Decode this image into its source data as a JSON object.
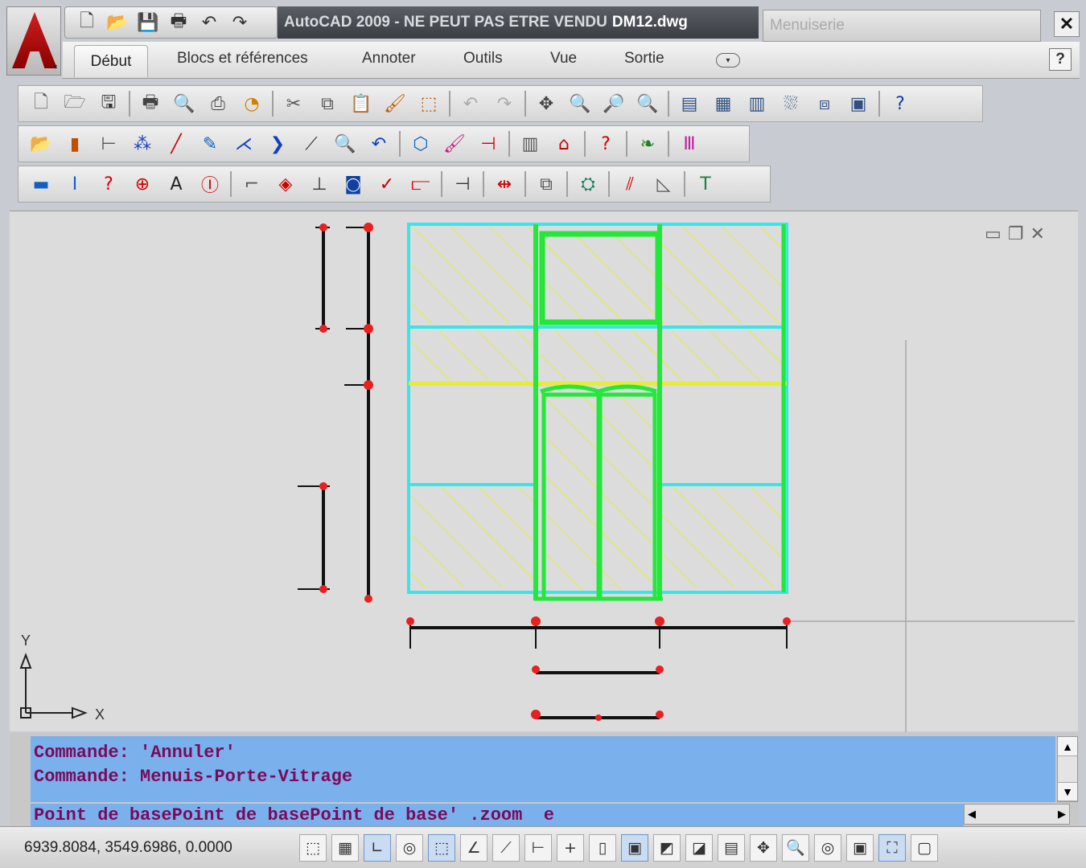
{
  "title_bar": {
    "app_title": "AutoCAD 2009 - NE PEUT PAS ETRE VENDU",
    "file_name": "DM12.dwg",
    "workspace": "Menuiserie",
    "close_glyph": "✕"
  },
  "quick_access": [
    {
      "name": "new-icon",
      "glyph": "🗋"
    },
    {
      "name": "open-icon",
      "glyph": "📂"
    },
    {
      "name": "save-icon",
      "glyph": "💾"
    },
    {
      "name": "print-icon",
      "glyph": "🖶"
    },
    {
      "name": "undo-icon",
      "glyph": "↶"
    },
    {
      "name": "redo-icon",
      "glyph": "↷"
    }
  ],
  "ribbon": {
    "tabs": [
      "Début",
      "Blocs et références",
      "Annoter",
      "Outils",
      "Vue",
      "Sortie"
    ],
    "toggle_glyph": "▾",
    "help_label": "?"
  },
  "toolbar_standard": [
    {
      "name": "new-icon",
      "glyph": "🗋",
      "color": "#555555"
    },
    {
      "name": "open-icon",
      "glyph": "🗁",
      "color": "#555555"
    },
    {
      "name": "save-icon",
      "glyph": "🖫",
      "color": "#333333"
    },
    {
      "sep": true
    },
    {
      "name": "plot-icon",
      "glyph": "🖶",
      "color": "#444444"
    },
    {
      "name": "plot-preview-icon",
      "glyph": "🔍",
      "color": "#444444"
    },
    {
      "name": "publish-icon",
      "glyph": "⎙",
      "color": "#444444"
    },
    {
      "name": "3d-dwf-icon",
      "glyph": "◔",
      "color": "#d08000"
    },
    {
      "sep": true
    },
    {
      "name": "cut-icon",
      "glyph": "✂",
      "color": "#555555"
    },
    {
      "name": "copy-icon",
      "glyph": "⧉",
      "color": "#555555"
    },
    {
      "name": "paste-icon",
      "glyph": "📋",
      "color": "#555555"
    },
    {
      "name": "match-properties-icon",
      "glyph": "🖌",
      "color": "#c06000"
    },
    {
      "name": "block-editor-icon",
      "glyph": "⬚",
      "color": "#c06000"
    },
    {
      "sep": true
    },
    {
      "name": "undo-icon",
      "glyph": "↶",
      "color": "#aaaaaa"
    },
    {
      "name": "redo-icon",
      "glyph": "↷",
      "color": "#aaaaaa"
    },
    {
      "sep": true
    },
    {
      "name": "pan-icon",
      "glyph": "✥",
      "color": "#444444"
    },
    {
      "name": "zoom-realtime-icon",
      "glyph": "🔍",
      "color": "#333333"
    },
    {
      "name": "zoom-window-icon",
      "glyph": "🔎",
      "color": "#333333"
    },
    {
      "name": "zoom-previous-icon",
      "glyph": "🔍",
      "color": "#333333"
    },
    {
      "sep": true
    },
    {
      "name": "properties-icon",
      "glyph": "▤",
      "color": "#305080"
    },
    {
      "name": "design-center-icon",
      "glyph": "▦",
      "color": "#305080"
    },
    {
      "name": "tool-palettes-icon",
      "glyph": "▥",
      "color": "#305080"
    },
    {
      "name": "sheet-set-icon",
      "glyph": "⛆",
      "color": "#305080"
    },
    {
      "name": "markup-icon",
      "glyph": "⧈",
      "color": "#305080"
    },
    {
      "name": "calculator-icon",
      "glyph": "▣",
      "color": "#305080"
    },
    {
      "sep": true
    },
    {
      "name": "help-icon",
      "glyph": "?",
      "color": "#1040a0"
    }
  ],
  "toolbar_menuis1": [
    {
      "name": "open-folder-icon",
      "glyph": "📂",
      "color": "#1060c0"
    },
    {
      "name": "wood-panel-icon",
      "glyph": "▮",
      "color": "#c05000"
    },
    {
      "name": "profile-icon",
      "glyph": "⊢",
      "color": "#555555"
    },
    {
      "name": "nodes-icon",
      "glyph": "⁂",
      "color": "#1040c0"
    },
    {
      "name": "line-icon",
      "glyph": "╱",
      "color": "#d00000"
    },
    {
      "name": "pencil-icon",
      "glyph": "✎",
      "color": "#1060c0"
    },
    {
      "name": "angle-icon",
      "glyph": "⋌",
      "color": "#1040c0"
    },
    {
      "name": "chevron-icon",
      "glyph": "❯",
      "color": "#1040c0"
    },
    {
      "name": "diagonal-icon",
      "glyph": "⟋",
      "color": "#333333"
    },
    {
      "name": "zoom-red-icon",
      "glyph": "🔍",
      "color": "#d00000"
    },
    {
      "name": "rotate-icon",
      "glyph": "↶",
      "color": "#1040c0"
    },
    {
      "sep": true
    },
    {
      "name": "group-icon",
      "glyph": "⬡",
      "color": "#1060c0"
    },
    {
      "name": "paint-icon",
      "glyph": "🖌",
      "color": "#c02080"
    },
    {
      "name": "dimension-icon",
      "glyph": "⊣",
      "color": "#d00000"
    },
    {
      "sep": true
    },
    {
      "name": "frame-icon",
      "glyph": "▥",
      "color": "#555555"
    },
    {
      "name": "house-icon",
      "glyph": "⌂",
      "color": "#c00000"
    },
    {
      "sep": true
    },
    {
      "name": "question-x-icon",
      "glyph": "?",
      "color": "#d00000"
    },
    {
      "sep": true
    },
    {
      "name": "leaf-icon",
      "glyph": "❧",
      "color": "#208020"
    },
    {
      "sep": true
    },
    {
      "name": "comb-icon",
      "glyph": "Ⅲ",
      "color": "#c020a0"
    }
  ],
  "toolbar_menuis2": [
    {
      "name": "panel-icon",
      "glyph": "▬",
      "color": "#1060c0"
    },
    {
      "name": "beam-icon",
      "glyph": "I",
      "color": "#1060c0"
    },
    {
      "name": "question-icon",
      "glyph": "?",
      "color": "#d00000"
    },
    {
      "name": "target-icon",
      "glyph": "⊕",
      "color": "#d00000"
    },
    {
      "name": "text-icon",
      "glyph": "A",
      "color": "#222222"
    },
    {
      "name": "i-frame-icon",
      "glyph": "Ⓘ",
      "color": "#d00000"
    },
    {
      "sep": true
    },
    {
      "name": "corner-icon",
      "glyph": "⌐",
      "color": "#555555"
    },
    {
      "name": "diamond-icon",
      "glyph": "◈",
      "color": "#d00000"
    },
    {
      "name": "auto-icon",
      "glyph": "⊥",
      "color": "#333333"
    },
    {
      "name": "tag-icon",
      "glyph": "◙",
      "color": "#1040a0"
    },
    {
      "name": "check-edit-icon",
      "glyph": "✓",
      "color": "#c00000"
    },
    {
      "name": "bracket-icon",
      "glyph": "⫍",
      "color": "#d00000"
    },
    {
      "sep": true
    },
    {
      "name": "insert-icon",
      "glyph": "⊣",
      "color": "#333333"
    },
    {
      "sep": true
    },
    {
      "name": "split-icon",
      "glyph": "⇹",
      "color": "#d00000"
    },
    {
      "sep": true
    },
    {
      "name": "copy-pages-icon",
      "glyph": "⧉",
      "color": "#555555"
    },
    {
      "sep": true
    },
    {
      "name": "export-icon",
      "glyph": "⛭",
      "color": "#208060"
    },
    {
      "sep": true
    },
    {
      "name": "door-icon",
      "glyph": "⫽",
      "color": "#d00000"
    },
    {
      "name": "ramp-icon",
      "glyph": "◺",
      "color": "#555555"
    },
    {
      "sep": true
    },
    {
      "name": "t-profile-icon",
      "glyph": "T",
      "color": "#208040"
    }
  ],
  "drawing": {
    "window_controls": [
      "▭",
      "❐",
      "✕"
    ],
    "ucs_x_label": "X",
    "ucs_y_label": "Y"
  },
  "command_line": {
    "lines": [
      "Commande: 'Annuler'",
      "Commande: Menuis-Porte-Vitrage"
    ],
    "input": "Point de basePoint de basePoint de base' .zoom  e"
  },
  "status_bar": {
    "coordinates": "6939.8084, 3549.6986, 0.0000",
    "buttons": [
      {
        "name": "snap-button",
        "glyph": "⬚",
        "on": false
      },
      {
        "name": "grid-button",
        "glyph": "▦",
        "on": false
      },
      {
        "name": "ortho-button",
        "glyph": "∟",
        "on": true
      },
      {
        "name": "polar-button",
        "glyph": "◎",
        "on": false
      },
      {
        "name": "osnap-button",
        "glyph": "⬚",
        "on": true
      },
      {
        "name": "3d-osnap-button",
        "glyph": "∠",
        "on": false
      },
      {
        "name": "otrack-button",
        "glyph": "⟋",
        "on": false
      },
      {
        "name": "ducs-button",
        "glyph": "⊢",
        "on": false
      },
      {
        "name": "dyn-button",
        "glyph": "+",
        "on": false
      },
      {
        "name": "lweight-button",
        "glyph": "▯",
        "on": false
      },
      {
        "name": "model-button",
        "glyph": "▣",
        "on": true
      },
      {
        "name": "layout-button",
        "glyph": "◩",
        "on": false
      },
      {
        "name": "layout2-button",
        "glyph": "◪",
        "on": false
      },
      {
        "name": "quickview-button",
        "glyph": "▤",
        "on": false
      },
      {
        "name": "pan-button",
        "glyph": "✥",
        "on": false
      },
      {
        "name": "zoom-button",
        "glyph": "🔍",
        "on": false
      },
      {
        "name": "steering-button",
        "glyph": "◎",
        "on": false
      },
      {
        "name": "showmotion-button",
        "glyph": "▣",
        "on": false
      },
      {
        "name": "annotation-button",
        "glyph": "⛶",
        "on": true
      },
      {
        "name": "fullscreen-button",
        "glyph": "▢",
        "on": false
      }
    ]
  },
  "colors": {
    "frame_green": "#22e83a",
    "frame_cyan": "#38e6ea",
    "hatch_yellow": "#e6ec3c",
    "dim_red": "#e82020",
    "dim_black": "#111111",
    "command_bg": "#7ab0ec",
    "command_text": "#7a0a5a"
  }
}
